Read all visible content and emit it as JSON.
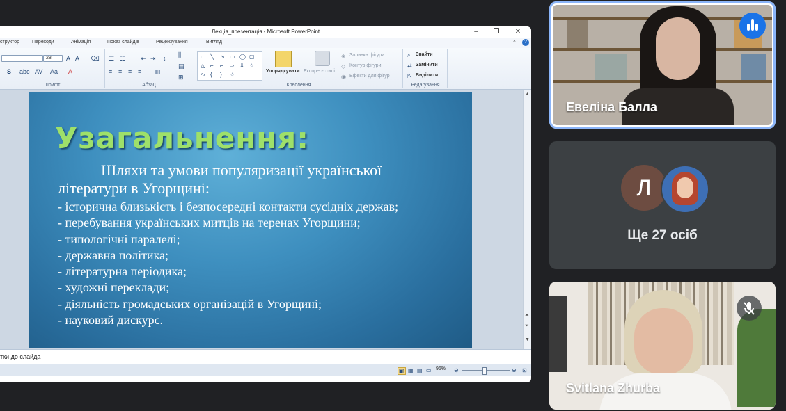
{
  "ppt": {
    "window_title": "Лекція_презентація - Microsoft PowerPoint",
    "menu": [
      "структор",
      "Переходи",
      "Анімація",
      "Показ слайдів",
      "Рецензування",
      "Вигляд"
    ],
    "ribbon": {
      "font_size": "28",
      "groups": {
        "font": "Шрифт",
        "paragraph": "Абзац",
        "drawing": "Креслення",
        "editing": "Редагування"
      },
      "arrange": "Упорядкувати",
      "quick_styles": "Експрес-стилі",
      "shape_fill": "Заливка фігури",
      "shape_outline": "Контур фігури",
      "shape_effects": "Ефекти для фігур",
      "find": "Знайти",
      "replace": "Замінити",
      "select": "Виділити"
    },
    "slide": {
      "title": "Узагальнення:",
      "subtitle": "Шляхи та умови популяризації української літератури в Угорщині:",
      "bullets": [
        "- історична близькість і безпосередні контакти сусідніх держав;",
        "- перебування українських митців на теренах Угорщини;",
        "- типологічні паралелі;",
        "- державна політика;",
        "- літературна періодика;",
        "- художні переклади;",
        "- діяльність громадських організацій в Угорщині;",
        "- науковий дискурс."
      ],
      "title_color": "#9ee06a"
    },
    "notes_placeholder": "тки до слайда",
    "zoom": "96%"
  },
  "participants": {
    "tile1_name": "Евеліна Балла",
    "tile2_avatar_letter": "Л",
    "tile2_more": "Ще 27 осіб",
    "tile3_name": "Svitlana Zhurba"
  },
  "colors": {
    "active_speaker": "#8ab4f8",
    "meet_bg": "#202124",
    "speaking": "#1a73e8"
  }
}
